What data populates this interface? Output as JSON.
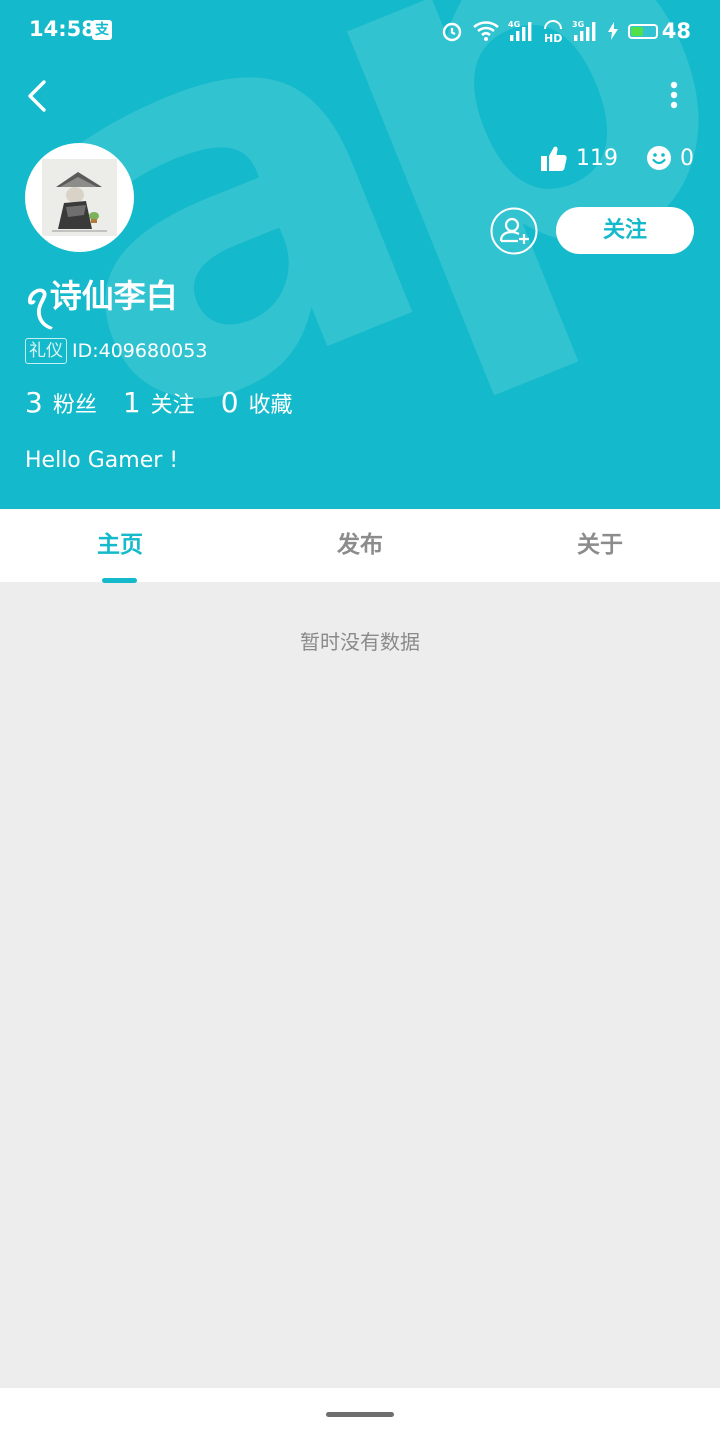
{
  "status_bar": {
    "time": "14:58",
    "pay_icon_char": "支",
    "battery_level": "48",
    "icons": [
      "alarm-icon",
      "wifi-icon",
      "signal-4g-icon",
      "hd-icon",
      "signal-3g-icon",
      "charging-icon",
      "battery-icon"
    ]
  },
  "watermark": "apTap",
  "profile": {
    "name": "ꪖ诗仙李白",
    "badge": "礼仪",
    "id": "ID:409680053",
    "bio": "Hello Gamer !",
    "stats": [
      {
        "value": "3",
        "label": "粉丝"
      },
      {
        "value": "1",
        "label": "关注"
      },
      {
        "value": "0",
        "label": "收藏"
      }
    ]
  },
  "reactions": {
    "likes": "119",
    "smiles": "0"
  },
  "actions": {
    "follow_label": "关注"
  },
  "tabs": [
    {
      "label": "主页",
      "active": true
    },
    {
      "label": "发布",
      "active": false
    },
    {
      "label": "关于",
      "active": false
    }
  ],
  "content": {
    "empty_message": "暂时没有数据"
  },
  "colors": {
    "accent": "#14bacb",
    "background": "#ededed"
  }
}
